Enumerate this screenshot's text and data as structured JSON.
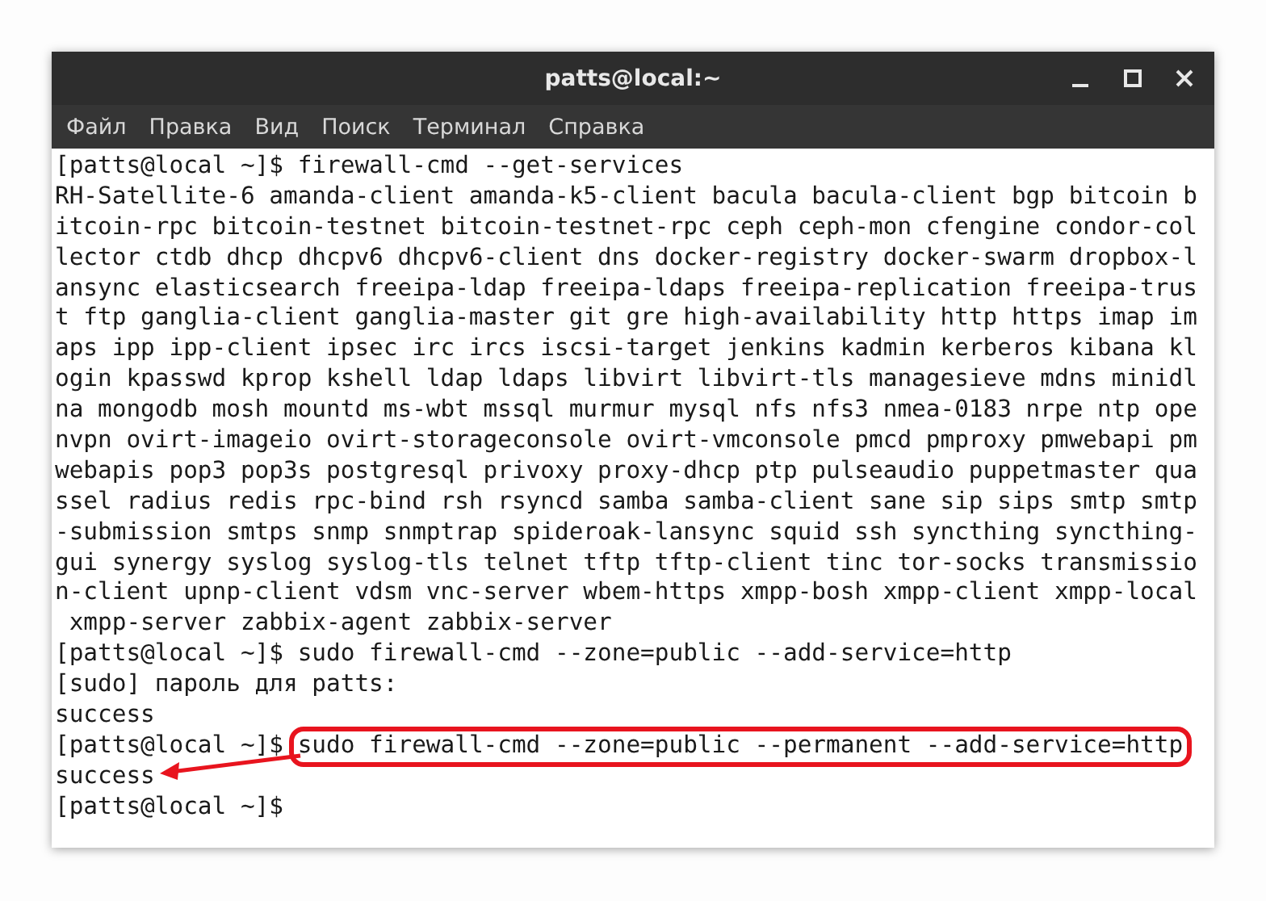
{
  "window": {
    "title": "patts@local:~"
  },
  "menu": [
    "Файл",
    "Правка",
    "Вид",
    "Поиск",
    "Терминал",
    "Справка"
  ],
  "lines": [
    {
      "kind": "command",
      "prompt": "[patts@local ~]$",
      "text": "firewall-cmd --get-services",
      "highlighted": false
    },
    {
      "kind": "output",
      "text": "RH-Satellite-6 amanda-client amanda-k5-client bacula bacula-client bgp bitcoin b"
    },
    {
      "kind": "output",
      "text": "itcoin-rpc bitcoin-testnet bitcoin-testnet-rpc ceph ceph-mon cfengine condor-col"
    },
    {
      "kind": "output",
      "text": "lector ctdb dhcp dhcpv6 dhcpv6-client dns docker-registry docker-swarm dropbox-l"
    },
    {
      "kind": "output",
      "text": "ansync elasticsearch freeipa-ldap freeipa-ldaps freeipa-replication freeipa-trus"
    },
    {
      "kind": "output",
      "text": "t ftp ganglia-client ganglia-master git gre high-availability http https imap im"
    },
    {
      "kind": "output",
      "text": "aps ipp ipp-client ipsec irc ircs iscsi-target jenkins kadmin kerberos kibana kl"
    },
    {
      "kind": "output",
      "text": "ogin kpasswd kprop kshell ldap ldaps libvirt libvirt-tls managesieve mdns minidl"
    },
    {
      "kind": "output",
      "text": "na mongodb mosh mountd ms-wbt mssql murmur mysql nfs nfs3 nmea-0183 nrpe ntp ope"
    },
    {
      "kind": "output",
      "text": "nvpn ovirt-imageio ovirt-storageconsole ovirt-vmconsole pmcd pmproxy pmwebapi pm"
    },
    {
      "kind": "output",
      "text": "webapis pop3 pop3s postgresql privoxy proxy-dhcp ptp pulseaudio puppetmaster qua"
    },
    {
      "kind": "output",
      "text": "ssel radius redis rpc-bind rsh rsyncd samba samba-client sane sip sips smtp smtp"
    },
    {
      "kind": "output",
      "text": "-submission smtps snmp snmptrap spideroak-lansync squid ssh syncthing syncthing-"
    },
    {
      "kind": "output",
      "text": "gui synergy syslog syslog-tls telnet tftp tftp-client tinc tor-socks transmissio"
    },
    {
      "kind": "output",
      "text": "n-client upnp-client vdsm vnc-server wbem-https xmpp-bosh xmpp-client xmpp-local"
    },
    {
      "kind": "output",
      "text": " xmpp-server zabbix-agent zabbix-server"
    },
    {
      "kind": "command",
      "prompt": "[patts@local ~]$",
      "text": "sudo firewall-cmd --zone=public --add-service=http",
      "highlighted": false
    },
    {
      "kind": "output",
      "text": "[sudo] пароль для patts:"
    },
    {
      "kind": "output",
      "text": "success"
    },
    {
      "kind": "command",
      "prompt": "[patts@local ~]$",
      "text": "sudo firewall-cmd --zone=public --permanent --add-service=http",
      "highlighted": true
    },
    {
      "kind": "output",
      "text": "success"
    },
    {
      "kind": "command",
      "prompt": "[patts@local ~]$",
      "highlighted": false
    }
  ]
}
